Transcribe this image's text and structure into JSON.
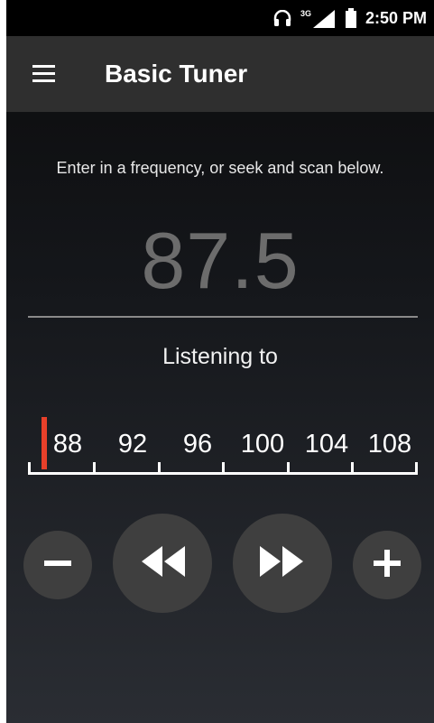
{
  "status_bar": {
    "time": "2:50 PM",
    "network_label": "3G",
    "icons": [
      "headphones-icon",
      "signal-icon",
      "battery-icon"
    ]
  },
  "app_bar": {
    "title": "Basic Tuner",
    "menu_icon": "hamburger-menu-icon"
  },
  "tuner": {
    "hint": "Enter in a frequency, or seek and scan below.",
    "frequency": "87.5",
    "listening_label": "Listening to",
    "scale_labels": [
      "88",
      "92",
      "96",
      "100",
      "104",
      "108"
    ],
    "needle_color": "#e8402a"
  },
  "controls": {
    "minus_icon": "minus-icon",
    "seek_back_icon": "rewind-icon",
    "seek_forward_icon": "fast-forward-icon",
    "plus_icon": "plus-icon"
  }
}
